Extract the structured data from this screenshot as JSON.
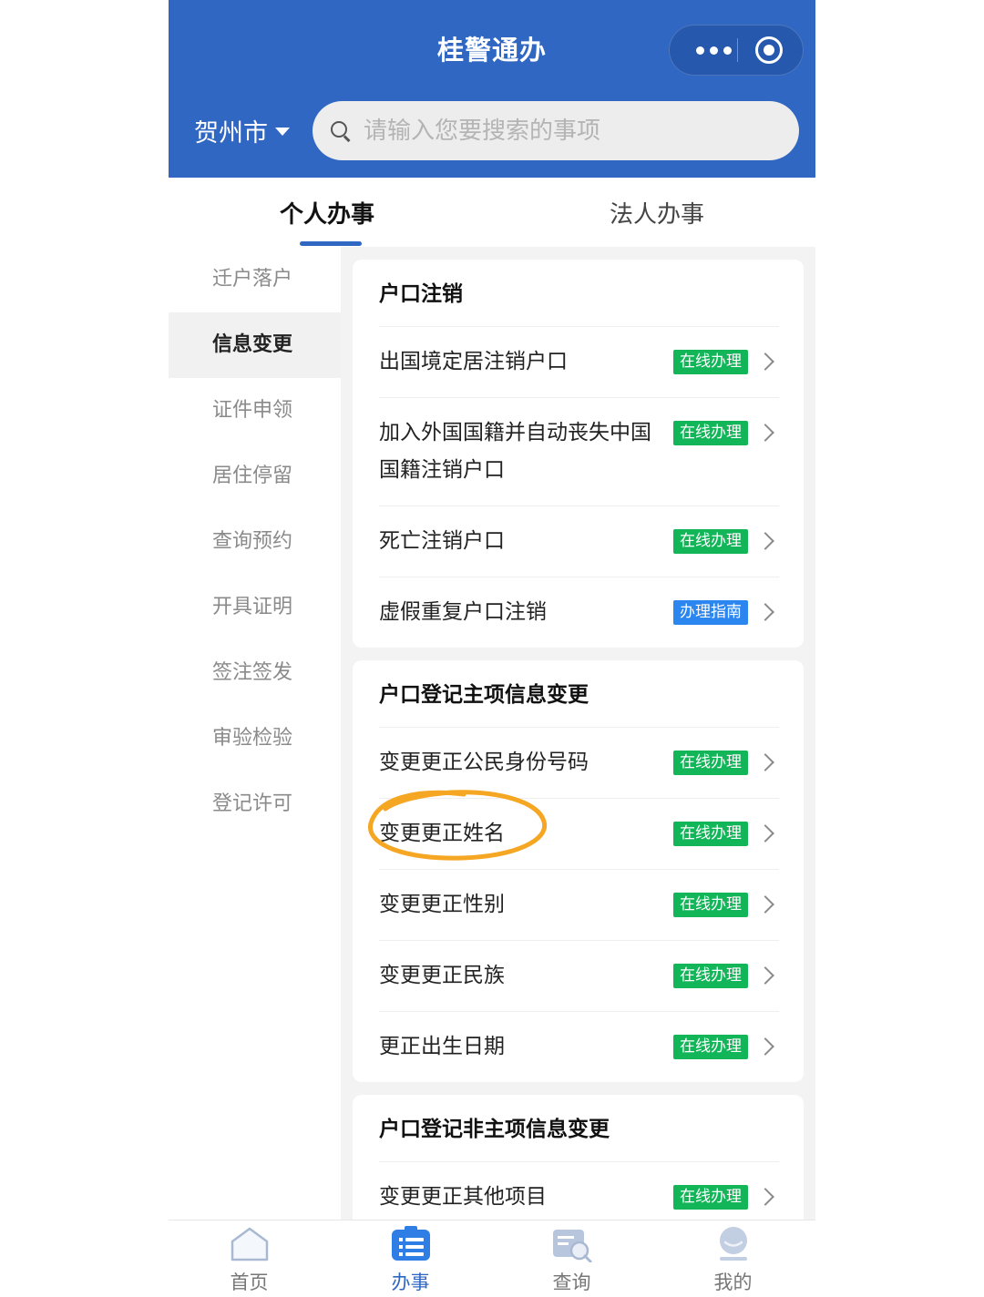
{
  "header": {
    "title": "桂警通办",
    "city": "贺州市",
    "search_placeholder": "请输入您要搜索的事项"
  },
  "tabs": [
    {
      "label": "个人办事",
      "active": true
    },
    {
      "label": "法人办事",
      "active": false
    }
  ],
  "sidebar": {
    "items": [
      {
        "label": "迁户落户",
        "active": false
      },
      {
        "label": "信息变更",
        "active": true
      },
      {
        "label": "证件申领",
        "active": false
      },
      {
        "label": "居住停留",
        "active": false
      },
      {
        "label": "查询预约",
        "active": false
      },
      {
        "label": "开具证明",
        "active": false
      },
      {
        "label": "签注签发",
        "active": false
      },
      {
        "label": "审验检验",
        "active": false
      },
      {
        "label": "登记许可",
        "active": false
      }
    ]
  },
  "sections": [
    {
      "title": "户口注销",
      "items": [
        {
          "label": "出国境定居注销户口",
          "badge": "在线办理",
          "badge_type": "green"
        },
        {
          "label": "加入外国国籍并自动丧失中国国籍注销户口",
          "badge": "在线办理",
          "badge_type": "green"
        },
        {
          "label": "死亡注销户口",
          "badge": "在线办理",
          "badge_type": "green"
        },
        {
          "label": "虚假重复户口注销",
          "badge": "办理指南",
          "badge_type": "blue"
        }
      ]
    },
    {
      "title": "户口登记主项信息变更",
      "items": [
        {
          "label": "变更更正公民身份号码",
          "badge": "在线办理",
          "badge_type": "green"
        },
        {
          "label": "变更更正姓名",
          "badge": "在线办理",
          "badge_type": "green",
          "highlighted": true
        },
        {
          "label": "变更更正性别",
          "badge": "在线办理",
          "badge_type": "green"
        },
        {
          "label": "变更更正民族",
          "badge": "在线办理",
          "badge_type": "green"
        },
        {
          "label": "更正出生日期",
          "badge": "在线办理",
          "badge_type": "green"
        }
      ]
    },
    {
      "title": "户口登记非主项信息变更",
      "items": [
        {
          "label": "变更更正其他项目",
          "badge": "在线办理",
          "badge_type": "green"
        }
      ]
    }
  ],
  "bottom_nav": [
    {
      "label": "首页",
      "icon": "home-icon",
      "active": false
    },
    {
      "label": "办事",
      "icon": "task-list-icon",
      "active": true
    },
    {
      "label": "查询",
      "icon": "query-search-icon",
      "active": false
    },
    {
      "label": "我的",
      "icon": "profile-icon",
      "active": false
    }
  ],
  "colors": {
    "brand_blue": "#2f67c3",
    "badge_green": "#12b659",
    "badge_blue": "#2c86ef",
    "highlight_orange": "#f5a623"
  }
}
